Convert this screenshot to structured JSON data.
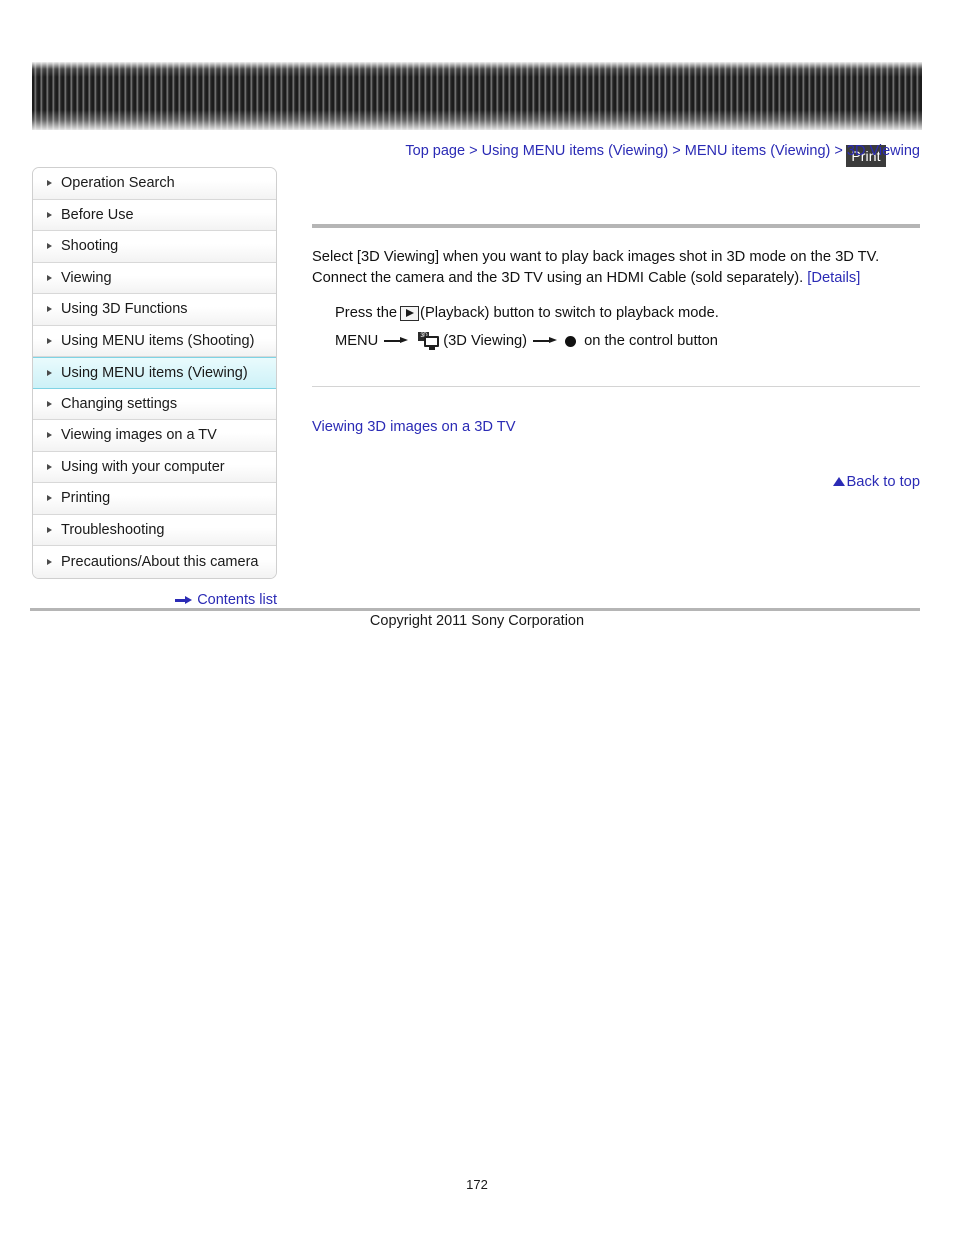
{
  "header": {
    "print_label": "Print"
  },
  "breadcrumb": {
    "items": [
      {
        "label": "Top page"
      },
      {
        "label": "Using MENU items (Viewing)"
      },
      {
        "label": "MENU items (Viewing)"
      },
      {
        "label": "3D Viewing"
      }
    ],
    "separator": ">"
  },
  "sidebar": {
    "items": [
      {
        "label": "Operation Search",
        "active": false
      },
      {
        "label": "Before Use",
        "active": false
      },
      {
        "label": "Shooting",
        "active": false
      },
      {
        "label": "Viewing",
        "active": false
      },
      {
        "label": "Using 3D Functions",
        "active": false
      },
      {
        "label": "Using MENU items (Shooting)",
        "active": false
      },
      {
        "label": "Using MENU items (Viewing)",
        "active": true
      },
      {
        "label": "Changing settings",
        "active": false
      },
      {
        "label": "Viewing images on a TV",
        "active": false
      },
      {
        "label": "Using with your computer",
        "active": false
      },
      {
        "label": "Printing",
        "active": false
      },
      {
        "label": "Troubleshooting",
        "active": false
      },
      {
        "label": "Precautions/About this camera",
        "active": false
      }
    ],
    "contents_link": "Contents list"
  },
  "main": {
    "paragraph_part1": "Select [3D Viewing] when you want to play back images shot in 3D mode on the 3D TV. Connect the camera and the 3D TV using an HDMI Cable (sold separately). ",
    "details_link": "[Details]",
    "step1_prefix": "Press the ",
    "step1_suffix": "(Playback) button to switch to playback mode.",
    "step2_menu": "MENU",
    "step2_label": "(3D Viewing)",
    "step2_suffix": "on the control button",
    "icon_3d_badge": "3D",
    "section_link": "Viewing 3D images on a 3D TV",
    "back_to_top": "Back to top"
  },
  "footer": {
    "copyright": "Copyright 2011 Sony Corporation",
    "page_number": "172"
  },
  "colors": {
    "link": "#2b2bb5",
    "active_nav_bg": "#cdf1f7",
    "active_nav_border": "#7fd3e4",
    "rule": "#b5b5b5"
  }
}
